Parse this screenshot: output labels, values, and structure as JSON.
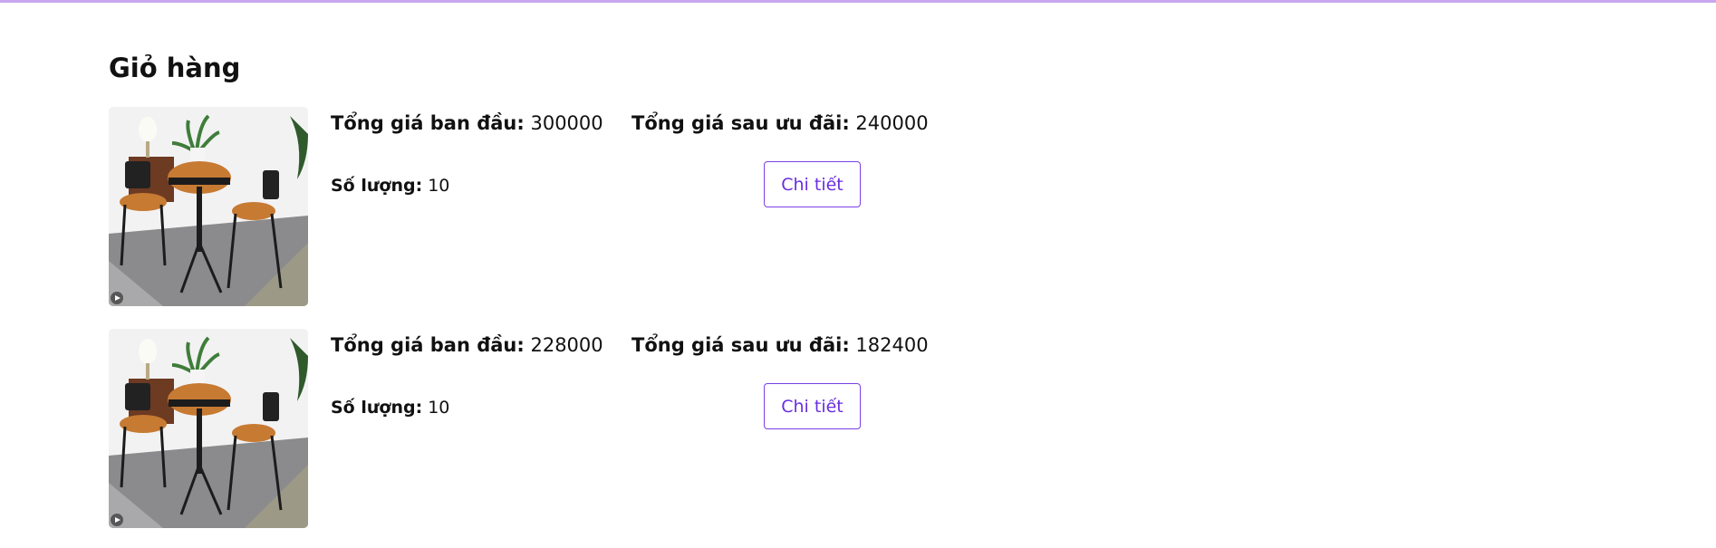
{
  "page": {
    "title": "Giỏ hàng",
    "accent_color": "#7b3fe4",
    "top_line_color": "#c9a7ee"
  },
  "cart": {
    "items": [
      {
        "image_icon": "table-chairs-photo",
        "original_label": "Tổng giá ban đầu:",
        "original_value": "300000",
        "discount_label": "Tổng giá sau ưu đãi:",
        "discount_value": "240000",
        "qty_label": "Số lượng:",
        "qty_value": "10",
        "detail_button": "Chi tiết"
      },
      {
        "image_icon": "table-chairs-photo",
        "original_label": "Tổng giá ban đầu:",
        "original_value": "228000",
        "discount_label": "Tổng giá sau ưu đãi:",
        "discount_value": "182400",
        "qty_label": "Số lượng:",
        "qty_value": "10",
        "detail_button": "Chi tiết"
      }
    ]
  }
}
